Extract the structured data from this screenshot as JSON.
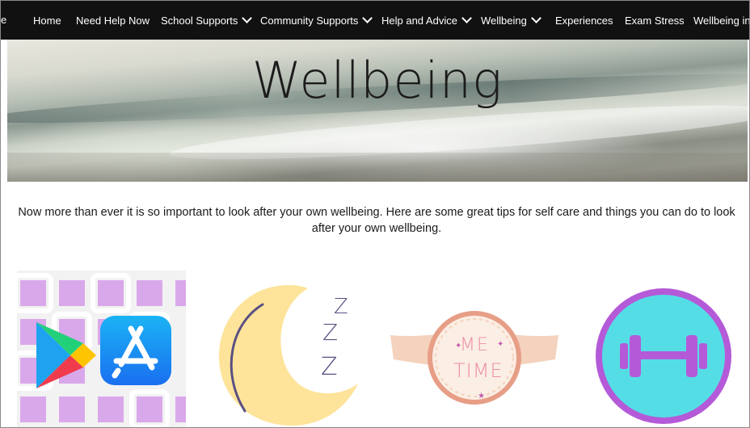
{
  "nav": {
    "cut_label": "e",
    "items": [
      {
        "label": "Home"
      },
      {
        "label": "Need Help Now"
      },
      {
        "label": "School Supports"
      },
      {
        "label": "Community Supports"
      },
      {
        "label": "Help and Advice"
      },
      {
        "label": "Wellbeing"
      },
      {
        "label": "Experiences"
      },
      {
        "label": "Exam Stress"
      },
      {
        "label": "Wellbeing in"
      }
    ]
  },
  "hero": {
    "title": "Wellbeing"
  },
  "intro": {
    "text": "Now more than ever it is so important to look after your own wellbeing. Here are some great tips for self care and things you can do to look after your own wellbeing."
  },
  "tiles": {
    "me_time_line1": "ME",
    "me_time_line2": "TIME",
    "sleep_z": "Z"
  },
  "colors": {
    "nav_bg": "#111111",
    "lilac": "#d9a8ea",
    "moon": "#fde49a",
    "cyan": "#55dde6",
    "purple": "#b45ad8",
    "peach": "#f4d2bd",
    "salmon": "#e79e86"
  }
}
